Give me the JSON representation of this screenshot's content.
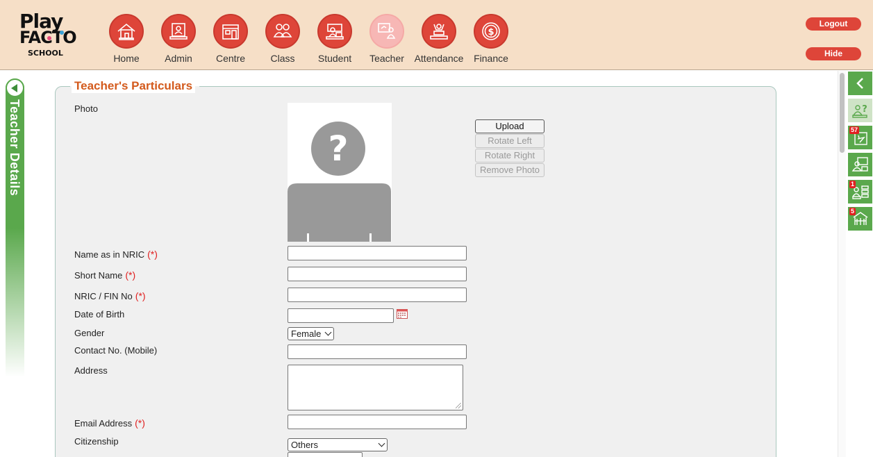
{
  "header": {
    "logo": {
      "line1": "Play",
      "line2": "FACTO",
      "line3": "SCHOOL"
    },
    "nav": [
      {
        "label": "Home",
        "icon": "home-icon"
      },
      {
        "label": "Admin",
        "icon": "admin-icon"
      },
      {
        "label": "Centre",
        "icon": "centre-icon"
      },
      {
        "label": "Class",
        "icon": "class-icon"
      },
      {
        "label": "Student",
        "icon": "student-icon"
      },
      {
        "label": "Teacher",
        "icon": "teacher-icon",
        "active": true
      },
      {
        "label": "Attendance",
        "icon": "attendance-icon"
      },
      {
        "label": "Finance",
        "icon": "finance-icon"
      }
    ],
    "logout_label": "Logout",
    "hide_label": "Hide"
  },
  "side_tab": {
    "label": "Teacher Details"
  },
  "form": {
    "section_title": "Teacher's Particulars",
    "photo_label": "Photo",
    "photo_buttons": {
      "upload": "Upload",
      "rotate_left": "Rotate Left",
      "rotate_right": "Rotate Right",
      "remove_photo": "Remove Photo"
    },
    "required_marker": "(*)",
    "fields": {
      "name_nric": {
        "label": "Name as in NRIC",
        "value": ""
      },
      "short_name": {
        "label": "Short Name",
        "value": ""
      },
      "nric_fin": {
        "label": "NRIC / FIN No",
        "value": ""
      },
      "dob": {
        "label": "Date of Birth",
        "value": ""
      },
      "gender": {
        "label": "Gender",
        "value": "Female"
      },
      "contact": {
        "label": "Contact No. (Mobile)",
        "value": ""
      },
      "address": {
        "label": "Address",
        "value": ""
      },
      "email": {
        "label": "Email Address",
        "value": ""
      },
      "citizenship": {
        "label": "Citizenship",
        "value": "Others"
      }
    }
  },
  "dock": {
    "items": [
      {
        "icon": "collapse-chevron-icon"
      },
      {
        "icon": "teacher-help-icon"
      },
      {
        "icon": "leave-icon",
        "badge": "57"
      },
      {
        "icon": "teacher-class-icon"
      },
      {
        "icon": "teacher-list-icon",
        "badge": "1"
      },
      {
        "icon": "classroom-icon",
        "badge": "5"
      }
    ]
  },
  "colors": {
    "accent_red": "#de4539",
    "header_bg": "#f6dfc7",
    "green": "#5aa84c",
    "title_orange": "#d35a1c"
  }
}
